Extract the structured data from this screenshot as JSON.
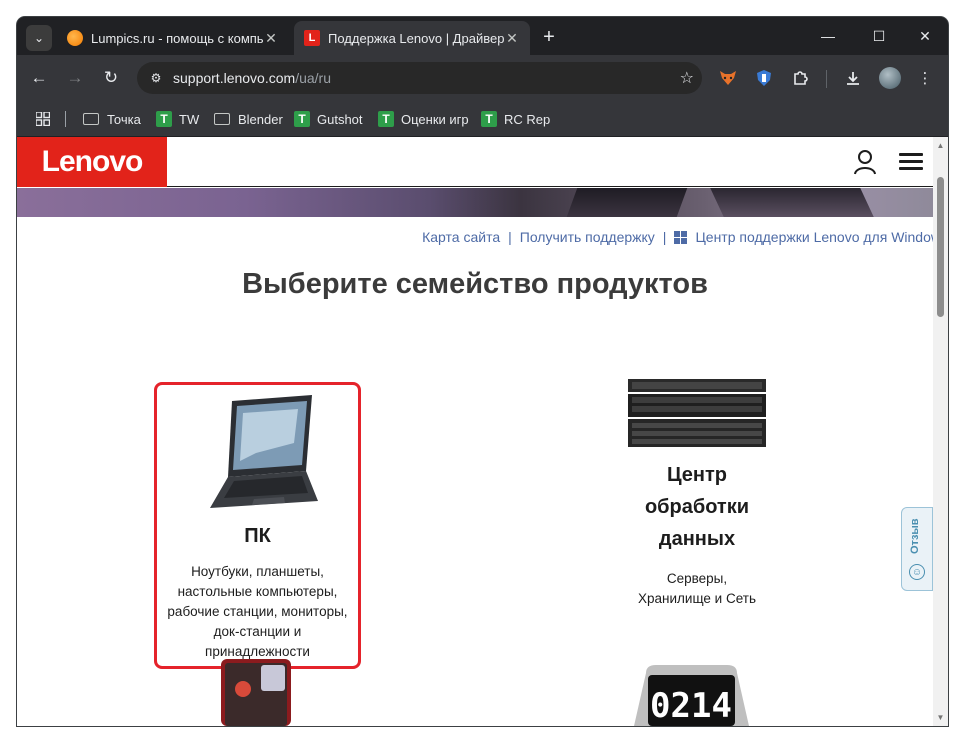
{
  "tabs": [
    {
      "title": "Lumpics.ru - помощь с компью",
      "active": false
    },
    {
      "title": "Поддержка Lenovo | Драйвер",
      "active": true
    }
  ],
  "tab_icons": {
    "search": "chevron-down-icon",
    "new_tab": "plus-icon",
    "close": "close-icon"
  },
  "window_controls": {
    "minimize": "—",
    "maximize": "☐",
    "close": "✕"
  },
  "toolbar": {
    "url_host": "support.lenovo.com",
    "url_path": "/ua/ru",
    "extensions": [
      "fox-extension-icon",
      "shield-extension-icon",
      "puzzle-icon",
      "download-icon",
      "profile-avatar",
      "kebab-menu-icon"
    ]
  },
  "bookmarks": [
    {
      "label": "Точка",
      "type": "folder"
    },
    {
      "label": "TW",
      "type": "site"
    },
    {
      "label": "Blender",
      "type": "folder"
    },
    {
      "label": "Gutshot",
      "type": "site"
    },
    {
      "label": "Оценки игр",
      "type": "site"
    },
    {
      "label": "RC Rep",
      "type": "site"
    }
  ],
  "page": {
    "logo": "Lenovo",
    "links": {
      "sitemap": "Карта сайта",
      "get_support": "Получить поддержку",
      "windows_center": "Центр поддержки Lenovo для Windows"
    },
    "heading": "Выберите семейство продуктов",
    "categories": [
      {
        "title": "ПК",
        "desc": "Ноутбуки, планшеты, настольные компьютеры, рабочие станции, мониторы, док-станции и принадлежности",
        "highlighted": true
      },
      {
        "title": "Центр обработки данных",
        "desc": "Серверы, Хранилище и Сеть",
        "highlighted": false
      }
    ],
    "feedback": "Отзыв",
    "clock_display": "0214"
  },
  "colors": {
    "lenovo_red": "#e2231a",
    "highlight": "#e5232b",
    "link": "#4e6ba6"
  }
}
